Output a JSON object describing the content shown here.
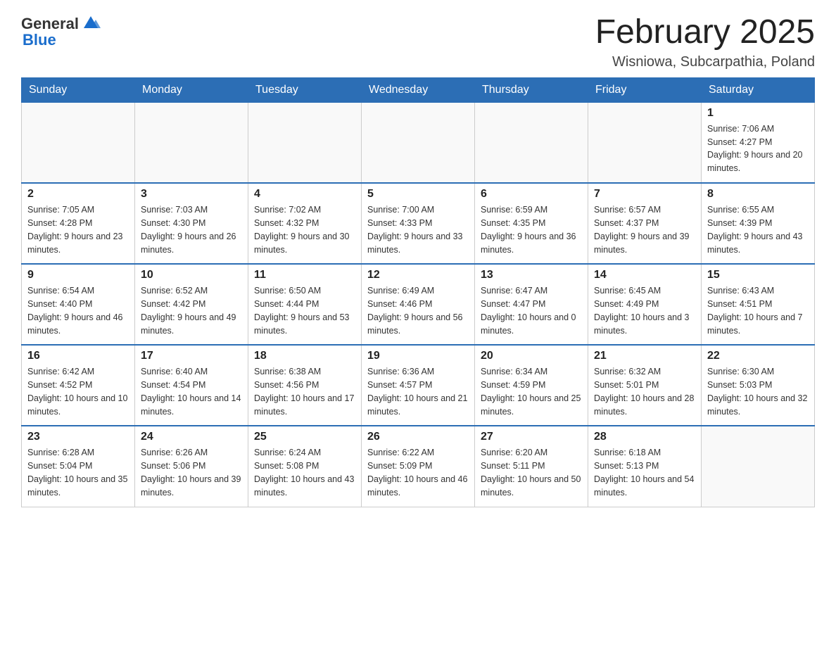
{
  "header": {
    "logo_general": "General",
    "logo_blue": "Blue",
    "month_title": "February 2025",
    "location": "Wisniowa, Subcarpathia, Poland"
  },
  "days_of_week": [
    "Sunday",
    "Monday",
    "Tuesday",
    "Wednesday",
    "Thursday",
    "Friday",
    "Saturday"
  ],
  "weeks": [
    {
      "days": [
        {
          "number": "",
          "info": ""
        },
        {
          "number": "",
          "info": ""
        },
        {
          "number": "",
          "info": ""
        },
        {
          "number": "",
          "info": ""
        },
        {
          "number": "",
          "info": ""
        },
        {
          "number": "",
          "info": ""
        },
        {
          "number": "1",
          "info": "Sunrise: 7:06 AM\nSunset: 4:27 PM\nDaylight: 9 hours and 20 minutes."
        }
      ]
    },
    {
      "days": [
        {
          "number": "2",
          "info": "Sunrise: 7:05 AM\nSunset: 4:28 PM\nDaylight: 9 hours and 23 minutes."
        },
        {
          "number": "3",
          "info": "Sunrise: 7:03 AM\nSunset: 4:30 PM\nDaylight: 9 hours and 26 minutes."
        },
        {
          "number": "4",
          "info": "Sunrise: 7:02 AM\nSunset: 4:32 PM\nDaylight: 9 hours and 30 minutes."
        },
        {
          "number": "5",
          "info": "Sunrise: 7:00 AM\nSunset: 4:33 PM\nDaylight: 9 hours and 33 minutes."
        },
        {
          "number": "6",
          "info": "Sunrise: 6:59 AM\nSunset: 4:35 PM\nDaylight: 9 hours and 36 minutes."
        },
        {
          "number": "7",
          "info": "Sunrise: 6:57 AM\nSunset: 4:37 PM\nDaylight: 9 hours and 39 minutes."
        },
        {
          "number": "8",
          "info": "Sunrise: 6:55 AM\nSunset: 4:39 PM\nDaylight: 9 hours and 43 minutes."
        }
      ]
    },
    {
      "days": [
        {
          "number": "9",
          "info": "Sunrise: 6:54 AM\nSunset: 4:40 PM\nDaylight: 9 hours and 46 minutes."
        },
        {
          "number": "10",
          "info": "Sunrise: 6:52 AM\nSunset: 4:42 PM\nDaylight: 9 hours and 49 minutes."
        },
        {
          "number": "11",
          "info": "Sunrise: 6:50 AM\nSunset: 4:44 PM\nDaylight: 9 hours and 53 minutes."
        },
        {
          "number": "12",
          "info": "Sunrise: 6:49 AM\nSunset: 4:46 PM\nDaylight: 9 hours and 56 minutes."
        },
        {
          "number": "13",
          "info": "Sunrise: 6:47 AM\nSunset: 4:47 PM\nDaylight: 10 hours and 0 minutes."
        },
        {
          "number": "14",
          "info": "Sunrise: 6:45 AM\nSunset: 4:49 PM\nDaylight: 10 hours and 3 minutes."
        },
        {
          "number": "15",
          "info": "Sunrise: 6:43 AM\nSunset: 4:51 PM\nDaylight: 10 hours and 7 minutes."
        }
      ]
    },
    {
      "days": [
        {
          "number": "16",
          "info": "Sunrise: 6:42 AM\nSunset: 4:52 PM\nDaylight: 10 hours and 10 minutes."
        },
        {
          "number": "17",
          "info": "Sunrise: 6:40 AM\nSunset: 4:54 PM\nDaylight: 10 hours and 14 minutes."
        },
        {
          "number": "18",
          "info": "Sunrise: 6:38 AM\nSunset: 4:56 PM\nDaylight: 10 hours and 17 minutes."
        },
        {
          "number": "19",
          "info": "Sunrise: 6:36 AM\nSunset: 4:57 PM\nDaylight: 10 hours and 21 minutes."
        },
        {
          "number": "20",
          "info": "Sunrise: 6:34 AM\nSunset: 4:59 PM\nDaylight: 10 hours and 25 minutes."
        },
        {
          "number": "21",
          "info": "Sunrise: 6:32 AM\nSunset: 5:01 PM\nDaylight: 10 hours and 28 minutes."
        },
        {
          "number": "22",
          "info": "Sunrise: 6:30 AM\nSunset: 5:03 PM\nDaylight: 10 hours and 32 minutes."
        }
      ]
    },
    {
      "days": [
        {
          "number": "23",
          "info": "Sunrise: 6:28 AM\nSunset: 5:04 PM\nDaylight: 10 hours and 35 minutes."
        },
        {
          "number": "24",
          "info": "Sunrise: 6:26 AM\nSunset: 5:06 PM\nDaylight: 10 hours and 39 minutes."
        },
        {
          "number": "25",
          "info": "Sunrise: 6:24 AM\nSunset: 5:08 PM\nDaylight: 10 hours and 43 minutes."
        },
        {
          "number": "26",
          "info": "Sunrise: 6:22 AM\nSunset: 5:09 PM\nDaylight: 10 hours and 46 minutes."
        },
        {
          "number": "27",
          "info": "Sunrise: 6:20 AM\nSunset: 5:11 PM\nDaylight: 10 hours and 50 minutes."
        },
        {
          "number": "28",
          "info": "Sunrise: 6:18 AM\nSunset: 5:13 PM\nDaylight: 10 hours and 54 minutes."
        },
        {
          "number": "",
          "info": ""
        }
      ]
    }
  ]
}
